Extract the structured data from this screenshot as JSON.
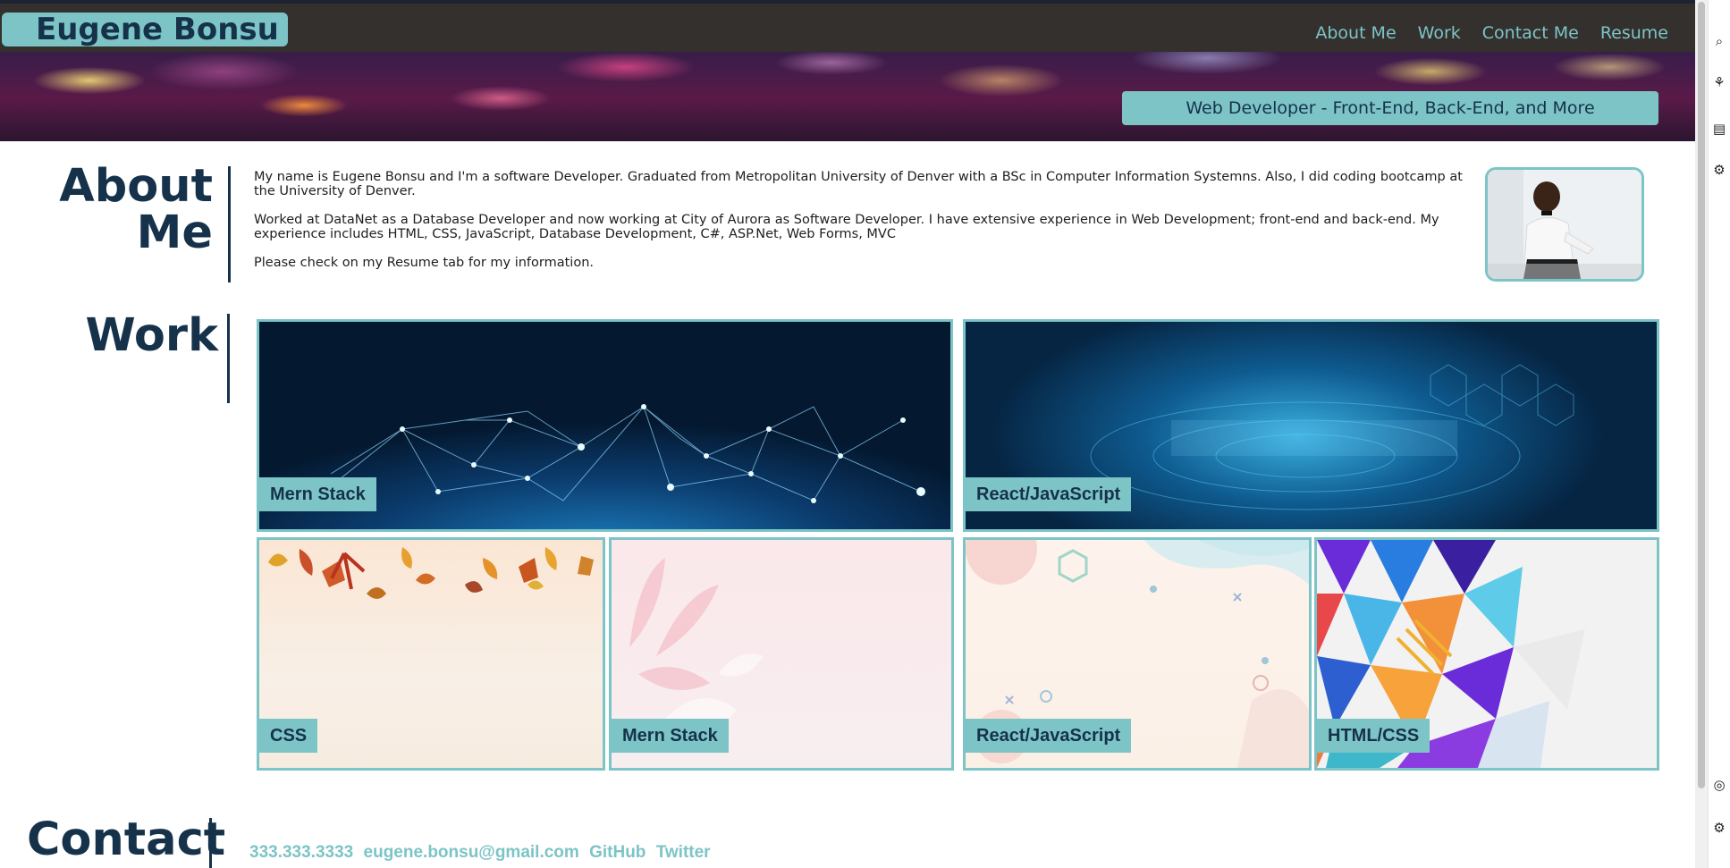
{
  "header": {
    "brand": "Eugene Bonsu",
    "nav": [
      "About Me",
      "Work",
      "Contact Me",
      "Resume"
    ],
    "tagline": "Web Developer - Front-End, Back-End, and More"
  },
  "about": {
    "title_line1": "About",
    "title_line2": "Me",
    "paragraphs": [
      "My name is Eugene Bonsu and I'm a software Developer. Graduated from Metropolitan University of Denver with a BSc in Computer Information Systemns. Also, I did coding bootcamp at the University of Denver.",
      "Worked at DataNet as a Database Developer and now working at City of Aurora as Software Developer. I have extensive experience in Web Development; front-end and back-end. My experience includes HTML, CSS, JavaScript, Database Development, C#, ASP.Net, Web Forms, MVC",
      "Please check on my Resume tab for my information."
    ]
  },
  "work": {
    "title": "Work",
    "tiles": [
      "Mern Stack",
      "React/JavaScript",
      "CSS",
      "Mern Stack",
      "React/JavaScript",
      "HTML/CSS"
    ]
  },
  "contact": {
    "title": "Contact",
    "phone": "333.333.3333",
    "email": "eugene.bonsu@gmail.com",
    "github": "GitHub",
    "twitter": "Twitter"
  },
  "colors": {
    "accent": "#7dc4c6",
    "heading": "#16324a",
    "topbar": "#34302e"
  }
}
